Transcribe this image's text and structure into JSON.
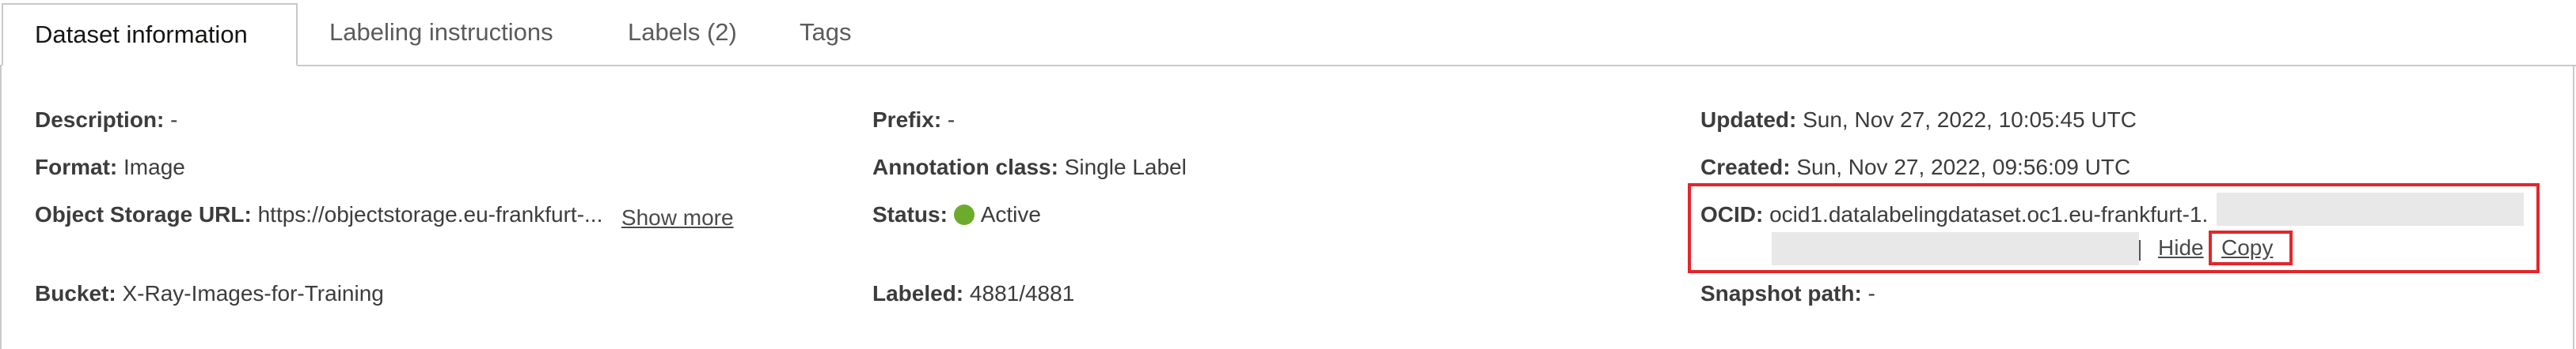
{
  "tabs": [
    {
      "label": "Dataset information",
      "active": true
    },
    {
      "label": "Labeling instructions",
      "active": false
    },
    {
      "label": "Labels (2)",
      "active": false
    },
    {
      "label": "Tags",
      "active": false
    }
  ],
  "details": {
    "description": {
      "label": "Description:",
      "value": " -"
    },
    "format": {
      "label": "Format:",
      "value": " Image"
    },
    "object_storage_url": {
      "label": "Object Storage URL:",
      "value": " https://objectstorage.eu-frankfurt-...",
      "show_more": "Show more"
    },
    "bucket": {
      "label": "Bucket:",
      "value": " X-Ray-Images-for-Training"
    },
    "prefix": {
      "label": "Prefix:",
      "value": " -"
    },
    "annotation_class": {
      "label": "Annotation class:",
      "value": " Single Label"
    },
    "status": {
      "label": "Status:",
      "value": "Active",
      "color": "#6cab2c"
    },
    "labeled": {
      "label": "Labeled:",
      "value": " 4881/4881"
    },
    "updated": {
      "label": "Updated:",
      "value": " Sun, Nov 27, 2022, 10:05:45 UTC"
    },
    "created": {
      "label": "Created:",
      "value": " Sun, Nov 27, 2022, 09:56:09 UTC"
    },
    "ocid": {
      "label": "OCID:",
      "value": " ocid1.datalabelingdataset.oc1.eu-frankfurt-1.",
      "hide": "Hide",
      "copy": "Copy"
    },
    "snapshot_path": {
      "label": "Snapshot path:",
      "value": " -"
    }
  },
  "colors": {
    "highlight": "#e3262b",
    "active_status": "#6cab2c",
    "border": "#c9c9c9"
  }
}
